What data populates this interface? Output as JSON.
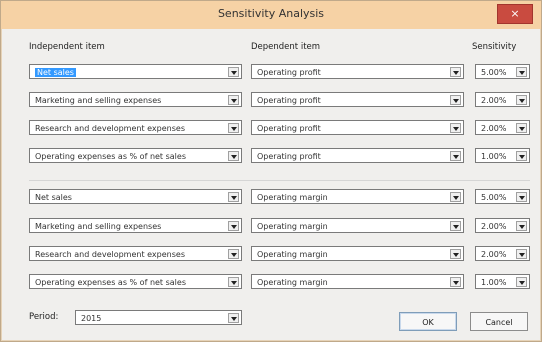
{
  "window": {
    "title": "Sensitivity Analysis",
    "close_label": "×"
  },
  "headers": {
    "independent": "Independent item",
    "dependent": "Dependent item",
    "sensitivity": "Sensitivity"
  },
  "rows": [
    {
      "independent": "Net sales",
      "dependent": "Operating profit",
      "sensitivity": "5.00%"
    },
    {
      "independent": "Marketing and selling expenses",
      "dependent": "Operating profit",
      "sensitivity": "2.00%"
    },
    {
      "independent": "Research and development expenses",
      "dependent": "Operating profit",
      "sensitivity": "2.00%"
    },
    {
      "independent": "Operating expenses as % of net sales",
      "dependent": "Operating profit",
      "sensitivity": "1.00%"
    },
    {
      "independent": "Net sales",
      "dependent": "Operating margin",
      "sensitivity": "5.00%"
    },
    {
      "independent": "Marketing and selling expenses",
      "dependent": "Operating margin",
      "sensitivity": "2.00%"
    },
    {
      "independent": "Research and development expenses",
      "dependent": "Operating margin",
      "sensitivity": "2.00%"
    },
    {
      "independent": "Operating expenses as % of net sales",
      "dependent": "Operating margin",
      "sensitivity": "1.00%"
    }
  ],
  "period": {
    "label": "Period:",
    "value": "2015"
  },
  "buttons": {
    "ok": "OK",
    "cancel": "Cancel"
  },
  "colors": {
    "titlebar": "#f6d2a5",
    "close": "#c94b40",
    "selection": "#3399ff"
  }
}
